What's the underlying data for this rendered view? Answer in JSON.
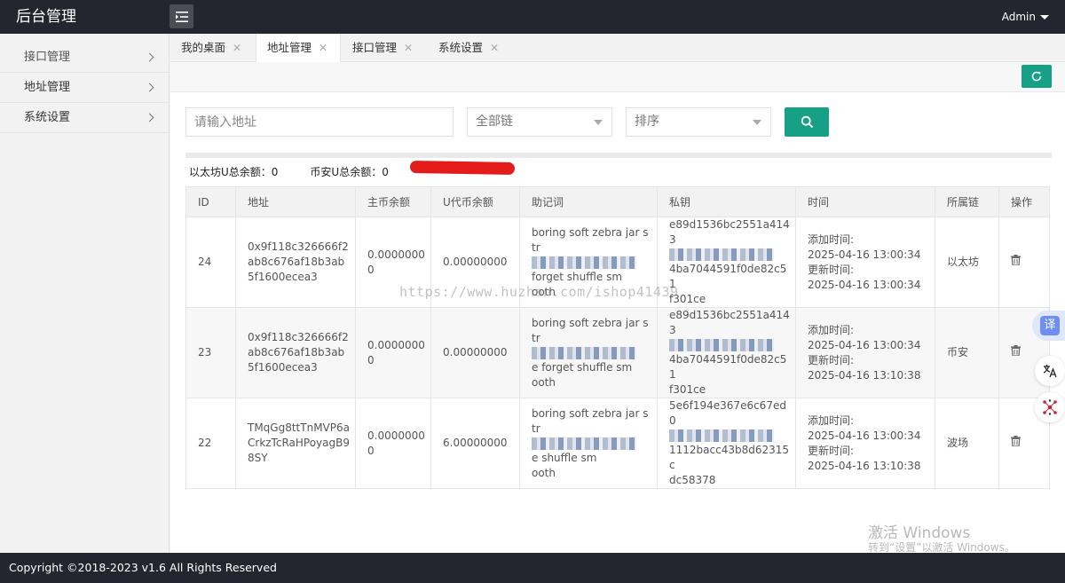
{
  "header": {
    "brand": "后台管理",
    "user": "Admin"
  },
  "sidebar": {
    "items": [
      {
        "label": "接口管理"
      },
      {
        "label": "地址管理"
      },
      {
        "label": "系统设置"
      }
    ]
  },
  "tabs": [
    {
      "label": "我的桌面"
    },
    {
      "label": "地址管理"
    },
    {
      "label": "接口管理"
    },
    {
      "label": "系统设置"
    }
  ],
  "filters": {
    "address_placeholder": "请输入地址",
    "chain_select": "全部链",
    "sort_select": "排序"
  },
  "totals": {
    "eth": "以太坊U总余额：0",
    "bsc": "币安U总余额：0"
  },
  "table": {
    "columns": [
      "ID",
      "地址",
      "主币余额",
      "U代币余额",
      "助记词",
      "私钥",
      "时间",
      "所属链",
      "操作"
    ],
    "rows": [
      {
        "id": "24",
        "address": "0x9f118c326666f2ab8c676af18b3ab5f1600ecea3",
        "main_balance": "0.00000000",
        "u_balance": "0.00000000",
        "mnemonic_start": "boring soft zebra jar str",
        "mnemonic_mid": "forget shuffle sm",
        "mnemonic_end": "ooth",
        "key_start": "e89d1536bc2551a4143",
        "key_mid": "4ba7044591f0de82c51",
        "key_end": "f301ce",
        "added_label": "添加时间:",
        "added": "2025-04-16 13:00:34",
        "updated_label": "更新时间:",
        "updated": "2025-04-16 13:00:34",
        "chain": "以太坊"
      },
      {
        "id": "23",
        "address": "0x9f118c326666f2ab8c676af18b3ab5f1600ecea3",
        "main_balance": "0.00000000",
        "u_balance": "0.00000000",
        "mnemonic_start": "boring soft zebra jar str",
        "mnemonic_mid": "e forget shuffle sm",
        "mnemonic_end": "ooth",
        "key_start": "e89d1536bc2551a4143",
        "key_mid": "4ba7044591f0de82c51",
        "key_end": "f301ce",
        "added_label": "添加时间:",
        "added": "2025-04-16 13:00:34",
        "updated_label": "更新时间:",
        "updated": "2025-04-16 13:10:38",
        "chain": "币安"
      },
      {
        "id": "22",
        "address": "TMqGg8ttTnMVP6aCrkzTcRaHPoyagB98SY",
        "main_balance": "0.00000000",
        "u_balance": "6.00000000",
        "mnemonic_start": "boring soft zebra jar str",
        "mnemonic_mid": "e shuffle sm",
        "mnemonic_end": "ooth",
        "key_start": "5e6f194e367e6c67ed0",
        "key_mid": "1112bacc43b8d62315c",
        "key_end": "dc58378",
        "added_label": "添加时间:",
        "added": "2025-04-16 13:00:34",
        "updated_label": "更新时间:",
        "updated": "2025-04-16 13:10:38",
        "chain": "波场"
      }
    ]
  },
  "watermark": "https://www.huzhan.com/ishop41439",
  "windows_watermark": {
    "line1": "激活 Windows",
    "line2": "转到“设置”以激活 Windows。"
  },
  "floating": {
    "translate_label": "译"
  },
  "footer": {
    "text": "Copyright ©2018-2023 v1.6 All Rights Reserved"
  },
  "colors": {
    "header_bg": "#23262e",
    "accent": "#16a085",
    "redaction": "#e31b1b"
  },
  "icons": [
    "menu-icon",
    "refresh-icon",
    "search-icon",
    "trash-icon",
    "close-icon",
    "chevron-right-icon",
    "caret-down-icon",
    "translate-icon"
  ]
}
